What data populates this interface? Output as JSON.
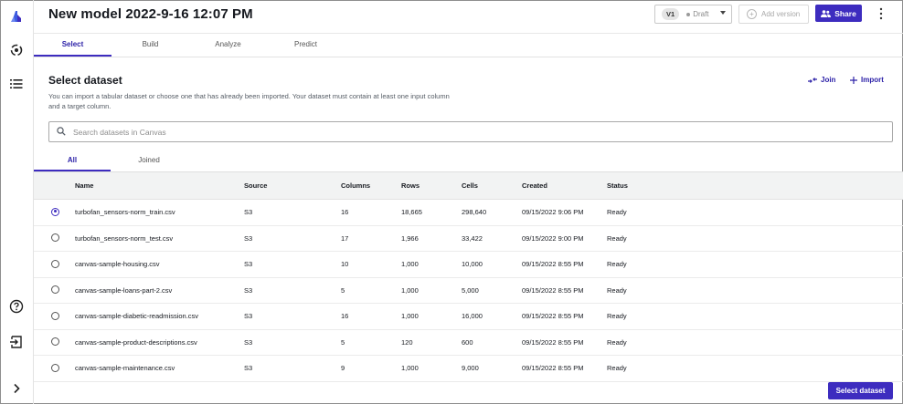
{
  "header": {
    "title": "New model 2022-9-16 12:07 PM",
    "version": "V1",
    "status": "Draft",
    "add_version": "Add version",
    "share": "Share"
  },
  "tabs": [
    {
      "label": "Select",
      "active": true
    },
    {
      "label": "Build",
      "active": false
    },
    {
      "label": "Analyze",
      "active": false
    },
    {
      "label": "Predict",
      "active": false
    }
  ],
  "section": {
    "title": "Select dataset",
    "description": "You can import a tabular dataset or choose one that has already been imported. Your dataset must contain at least one input column and a target column.",
    "join": "Join",
    "import": "Import"
  },
  "search": {
    "placeholder": "Search datasets in Canvas"
  },
  "subtabs": [
    {
      "label": "All",
      "active": true
    },
    {
      "label": "Joined",
      "active": false
    }
  ],
  "table": {
    "headers": [
      "Name",
      "Source",
      "Columns",
      "Rows",
      "Cells",
      "Created",
      "Status"
    ],
    "rows": [
      {
        "selected": true,
        "name": "turbofan_sensors-norm_train.csv",
        "source": "S3",
        "columns": "16",
        "rows": "18,665",
        "cells": "298,640",
        "created": "09/15/2022 9:06 PM",
        "status": "Ready"
      },
      {
        "selected": false,
        "name": "turbofan_sensors-norm_test.csv",
        "source": "S3",
        "columns": "17",
        "rows": "1,966",
        "cells": "33,422",
        "created": "09/15/2022 9:00 PM",
        "status": "Ready"
      },
      {
        "selected": false,
        "name": "canvas-sample-housing.csv",
        "source": "S3",
        "columns": "10",
        "rows": "1,000",
        "cells": "10,000",
        "created": "09/15/2022 8:55 PM",
        "status": "Ready"
      },
      {
        "selected": false,
        "name": "canvas-sample-loans-part-2.csv",
        "source": "S3",
        "columns": "5",
        "rows": "1,000",
        "cells": "5,000",
        "created": "09/15/2022 8:55 PM",
        "status": "Ready"
      },
      {
        "selected": false,
        "name": "canvas-sample-diabetic-readmission.csv",
        "source": "S3",
        "columns": "16",
        "rows": "1,000",
        "cells": "16,000",
        "created": "09/15/2022 8:55 PM",
        "status": "Ready"
      },
      {
        "selected": false,
        "name": "canvas-sample-product-descriptions.csv",
        "source": "S3",
        "columns": "5",
        "rows": "120",
        "cells": "600",
        "created": "09/15/2022 8:55 PM",
        "status": "Ready"
      },
      {
        "selected": false,
        "name": "canvas-sample-maintenance.csv",
        "source": "S3",
        "columns": "9",
        "rows": "1,000",
        "cells": "9,000",
        "created": "09/15/2022 8:55 PM",
        "status": "Ready"
      }
    ]
  },
  "footer": {
    "select_button": "Select dataset"
  },
  "colors": {
    "accent": "#3d2cbf",
    "text": "#16191f",
    "muted": "#545b64"
  },
  "icons": {
    "rail": [
      "canvas-logo-icon",
      "models-icon",
      "datasets-list-icon",
      "help-icon",
      "sign-out-icon",
      "expand-chevron-icon"
    ]
  }
}
